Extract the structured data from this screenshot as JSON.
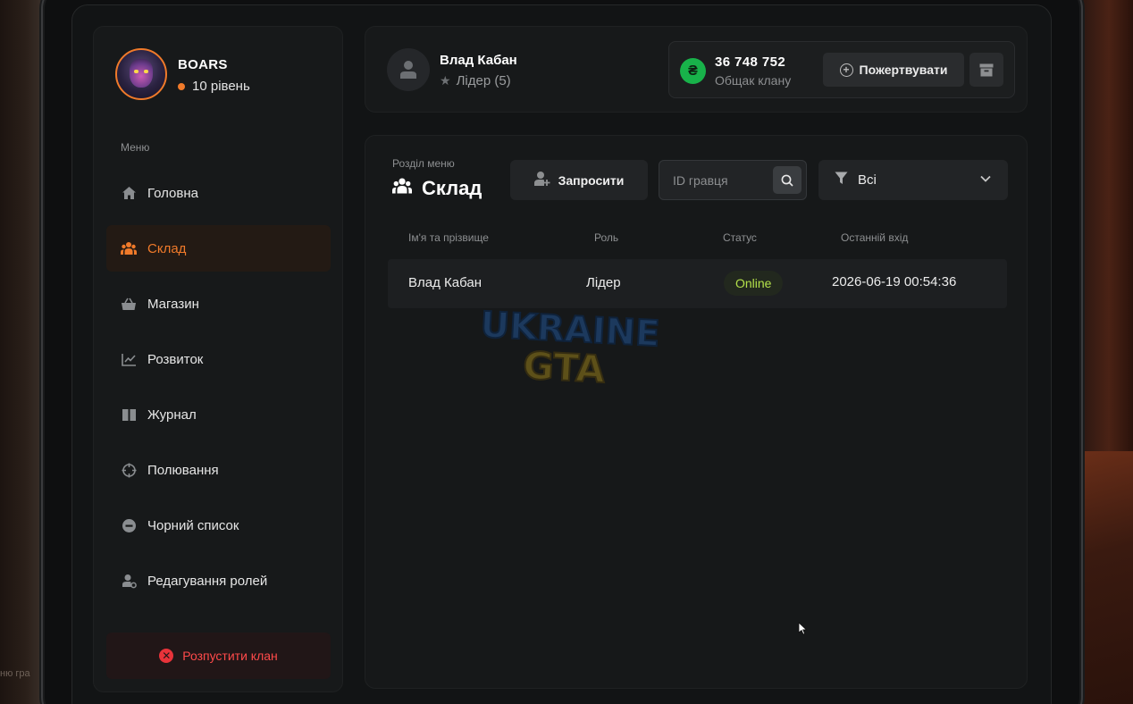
{
  "background": {
    "corner_text": "ню гра"
  },
  "clan": {
    "name": "BOARS",
    "level": "10 рівень",
    "accent": "#f07a2a"
  },
  "sidebar": {
    "caption": "Меню",
    "items": [
      {
        "label": "Головна",
        "icon": "home-icon"
      },
      {
        "label": "Склад",
        "icon": "people-icon",
        "active": true
      },
      {
        "label": "Магазин",
        "icon": "basket-icon"
      },
      {
        "label": "Розвиток",
        "icon": "chart-icon"
      },
      {
        "label": "Журнал",
        "icon": "book-icon"
      },
      {
        "label": "Полювання",
        "icon": "crosshair-icon"
      },
      {
        "label": "Чорний список",
        "icon": "block-icon"
      },
      {
        "label": "Редагування ролей",
        "icon": "user-settings-icon"
      }
    ],
    "disband_label": "Розпустити клан"
  },
  "header": {
    "user_name": "Влад Кабан",
    "user_role": "Лідер (5)",
    "currency_symbol": "₴",
    "money_amount": "36 748 752",
    "money_label": "Общак клану",
    "donate_label": "Пожертвувати"
  },
  "section": {
    "caption": "Розділ меню",
    "title": "Склад",
    "invite_label": "Запросити",
    "search_placeholder": "ID гравця",
    "filter_value": "Всі"
  },
  "table": {
    "columns": [
      "Ім'я та прізвище",
      "Роль",
      "Статус",
      "Останній вхід"
    ],
    "rows": [
      {
        "name": "Влад Кабан",
        "role": "Лідер",
        "status": "Online",
        "last_login": "2026-06-19 00:54:36"
      }
    ]
  },
  "watermark": {
    "line1": "UKRAINE",
    "line2": "GTA"
  }
}
